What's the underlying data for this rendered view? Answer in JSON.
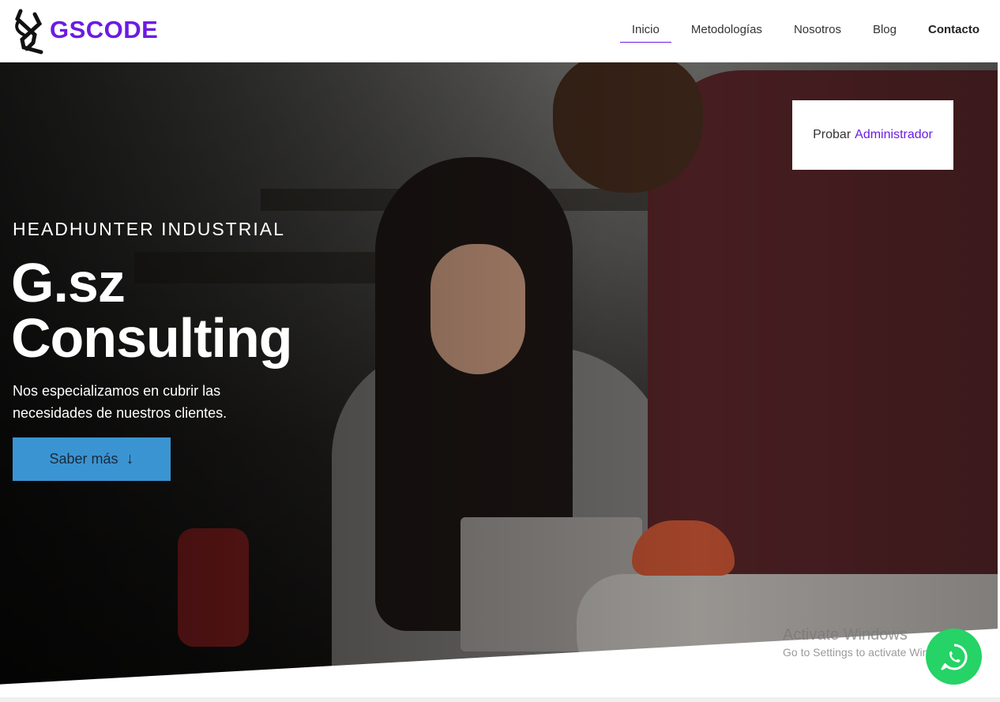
{
  "header": {
    "brand": "GSCODE",
    "nav": [
      {
        "label": "Inicio",
        "active": true
      },
      {
        "label": "Metodologías"
      },
      {
        "label": "Nosotros"
      },
      {
        "label": "Blog"
      },
      {
        "label": "Contacto",
        "bold": true
      }
    ]
  },
  "admin_box": {
    "prefix": "Probar",
    "link": "Administrador"
  },
  "hero": {
    "kicker": "HEADHUNTER INDUSTRIAL",
    "title_line1": "G.sz",
    "title_line2": "Consulting",
    "subtitle": "Nos especializamos en cubrir las necesidades de nuestros clientes.",
    "cta_label": "Saber más",
    "cta_icon": "arrow-down-icon"
  },
  "windows_notice": {
    "line1": "Activate Windows",
    "line2": "Go to Settings to activate Windows."
  },
  "colors": {
    "brand": "#6b1be3",
    "cta": "#3b94d2",
    "whatsapp": "#25d366"
  },
  "icons": {
    "logo": "gscode-logo-icon",
    "whatsapp": "whatsapp-icon"
  }
}
